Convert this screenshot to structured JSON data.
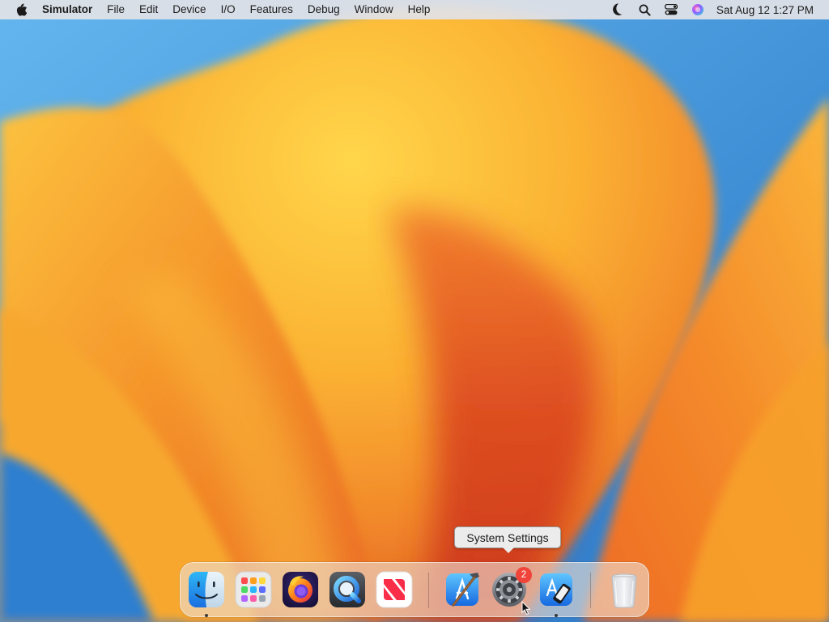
{
  "menubar": {
    "apple_icon": "apple-logo-icon",
    "app_name": "Simulator",
    "menus": [
      "File",
      "Edit",
      "Device",
      "I/O",
      "Features",
      "Debug",
      "Window",
      "Help"
    ],
    "status_icons": [
      "focus-moon-icon",
      "spotlight-search-icon",
      "control-center-icon",
      "siri-icon"
    ],
    "clock": "Sat Aug 12  1:27 PM"
  },
  "tooltip": {
    "text": "System Settings"
  },
  "dock": {
    "apps": [
      {
        "name": "Finder",
        "icon": "finder-icon",
        "running": true
      },
      {
        "name": "Launchpad",
        "icon": "launchpad-icon",
        "running": false
      },
      {
        "name": "Firefox",
        "icon": "firefox-icon",
        "running": false
      },
      {
        "name": "QuickTime Player",
        "icon": "quicktime-icon",
        "running": false
      },
      {
        "name": "News",
        "icon": "news-icon",
        "running": false
      },
      {
        "name": "Xcode",
        "icon": "xcode-icon",
        "running": false
      },
      {
        "name": "System Settings",
        "icon": "system-settings-gear-icon",
        "running": false,
        "badge": "2"
      },
      {
        "name": "Simulator",
        "icon": "simulator-icon",
        "running": true
      },
      {
        "name": "Trash",
        "icon": "trash-icon",
        "running": false
      }
    ]
  },
  "colors": {
    "menubar_bg": "#e2e2e6",
    "badge": "#f0443a",
    "wallpaper_orange": "#f39a24",
    "wallpaper_blue": "#3f8fd6"
  }
}
